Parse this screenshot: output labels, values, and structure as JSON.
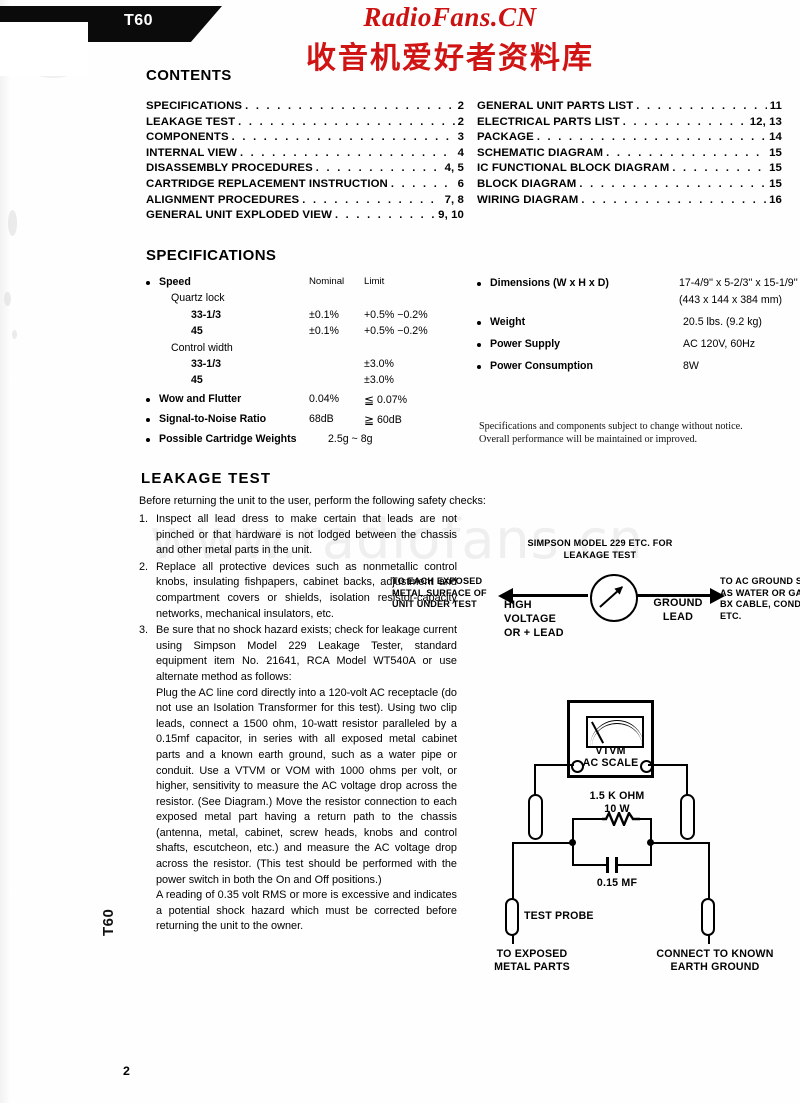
{
  "header": {
    "model_tab": "T60",
    "brand_latin": "RadioFans.CN",
    "brand_chinese": "收音机爱好者资料库",
    "body_watermark": "www.radiofans.cn"
  },
  "contents": {
    "heading": "CONTENTS",
    "left": [
      {
        "title": "SPECIFICATIONS",
        "page": "2"
      },
      {
        "title": "LEAKAGE TEST",
        "page": "2"
      },
      {
        "title": "COMPONENTS",
        "page": "3"
      },
      {
        "title": "INTERNAL VIEW",
        "page": "4"
      },
      {
        "title": "DISASSEMBLY PROCEDURES",
        "page": "4, 5"
      },
      {
        "title": "CARTRIDGE REPLACEMENT INSTRUCTION",
        "page": "6"
      },
      {
        "title": "ALIGNMENT PROCEDURES",
        "page": "7, 8"
      },
      {
        "title": "GENERAL UNIT EXPLODED VIEW",
        "page": "9, 10"
      }
    ],
    "right": [
      {
        "title": "GENERAL UNIT PARTS LIST",
        "page": "11"
      },
      {
        "title": "ELECTRICAL PARTS LIST",
        "page": "12, 13"
      },
      {
        "title": "PACKAGE",
        "page": "14"
      },
      {
        "title": "SCHEMATIC DIAGRAM",
        "page": "15"
      },
      {
        "title": "IC FUNCTIONAL BLOCK DIAGRAM",
        "page": "15"
      },
      {
        "title": "BLOCK DIAGRAM",
        "page": "15"
      },
      {
        "title": "WIRING DIAGRAM",
        "page": "16"
      }
    ]
  },
  "specifications": {
    "heading": "SPECIFICATIONS",
    "col_nominal": "Nominal",
    "col_limit": "Limit",
    "speed_label": "Speed",
    "quartz_lock_label": "Quartz lock",
    "quartz_33_label": "33-1/3",
    "quartz_33_nominal": "±0.1%",
    "quartz_33_limit": "+0.5% −0.2%",
    "quartz_45_label": "45",
    "quartz_45_nominal": "±0.1%",
    "quartz_45_limit": "+0.5% −0.2%",
    "control_width_label": "Control width",
    "cw_33_label": "33-1/3",
    "cw_33_limit": "±3.0%",
    "cw_45_label": "45",
    "cw_45_limit": "±3.0%",
    "wow_label": "Wow and Flutter",
    "wow_nominal": "0.04%",
    "wow_limit_sym": "≦",
    "wow_limit_val": "0.07%",
    "snr_label": "Signal-to-Noise Ratio",
    "snr_nominal": "68dB",
    "snr_limit_sym": "≧",
    "snr_limit_val": "60dB",
    "cartridge_label": "Possible Cartridge Weights",
    "cartridge_value": "2.5g ~ 8g",
    "dimensions_label": "Dimensions (W x H x D)",
    "dimensions_value": "17-4/9'' x 5-2/3'' x 15-1/9''",
    "dimensions_value_mm": "(443 x 144 x 384 mm)",
    "weight_label": "Weight",
    "weight_value": "20.5 lbs. (9.2 kg)",
    "power_supply_label": "Power Supply",
    "power_supply_value": "AC 120V, 60Hz",
    "power_consumption_label": "Power Consumption",
    "power_consumption_value": "8W",
    "note_line1": "Specifications and components subject to change without notice.",
    "note_line2": "Overall performance will be maintained or improved."
  },
  "leakage_test": {
    "heading": "LEAKAGE  TEST",
    "intro": "Before returning the unit to the user, perform the following safety checks:",
    "items": [
      {
        "number": "1.",
        "text": "Inspect all lead dress to make certain that leads are not pinched or that hardware is not lodged between the chassis and other metal parts in the unit."
      },
      {
        "number": "2.",
        "text": "Replace all protective devices such as nonmetallic control knobs, insulating fishpapers, cabinet backs, adjustment and compartment covers or shields, isolation resistor-capacity networks, mechanical insulators, etc."
      },
      {
        "number": "3.",
        "text": "Be sure that no shock hazard exists; check for leakage current using Simpson Model 229 Leakage Tester, standard equipment item No. 21641, RCA Model WT540A or use alternate method as follows:",
        "paragraph2": "Plug the AC line cord directly into a 120-volt AC receptacle (do not use an Isolation Transformer for this test). Using two clip leads, connect a 1500 ohm, 10-watt resistor paralleled by a 0.15mf capacitor, in series with all exposed metal cabinet parts and a known earth ground, such as a water pipe or conduit. Use a VTVM or VOM with 1000 ohms per volt, or higher, sensitivity to measure the AC voltage drop across the resistor. (See Diagram.) Move the resistor connection to each exposed metal part having a return path to the chassis (antenna, metal, cabinet, screw heads, knobs and control shafts, escutcheon, etc.) and measure the AC voltage drop across the resistor. (This test should be performed with the power switch in both the On and Off positions.)",
        "paragraph3": "A reading of 0.35 volt RMS or more is excessive and indicates a potential shock hazard which must be corrected before returning the unit to the owner."
      }
    ]
  },
  "meter_diagram": {
    "title_line1": "SIMPSON MODEL 229 ETC. FOR",
    "title_line2": "LEAKAGE TEST",
    "left_caption_line1": "TO EACH EXPOSED",
    "left_caption_line2": "METAL SURFACE OF",
    "left_caption_line3": "UNIT UNDER TEST",
    "high_voltage_line1": "HIGH",
    "high_voltage_line2": "VOLTAGE",
    "high_voltage_line3": "OR + LEAD",
    "ground_lead_line1": "GROUND",
    "ground_lead_line2": "LEAD",
    "right_caption_line1": "TO AC GROUND SUCH",
    "right_caption_line2": "AS WATER OR GAS PIPE,",
    "right_caption_line3": "BX CABLE, CONDUIT, ETC."
  },
  "circuit_diagram": {
    "vtvm_label": "VTVM",
    "ac_scale_label": "AC SCALE",
    "resistor_line1": "1.5 K OHM",
    "resistor_line2": "10 W",
    "capacitor_label": "0.15 MF",
    "test_probe_label": "TEST PROBE",
    "exposed_line1": "TO EXPOSED",
    "exposed_line2": "METAL PARTS",
    "earth_line1": "CONNECT TO KNOWN",
    "earth_line2": "EARTH GROUND"
  },
  "footer": {
    "side_tab": "T60",
    "page_number": "2"
  },
  "colors": {
    "brand_red": "#cc1111",
    "banner_black": "#0b0b0b",
    "watermark_gray": "#efefef"
  }
}
